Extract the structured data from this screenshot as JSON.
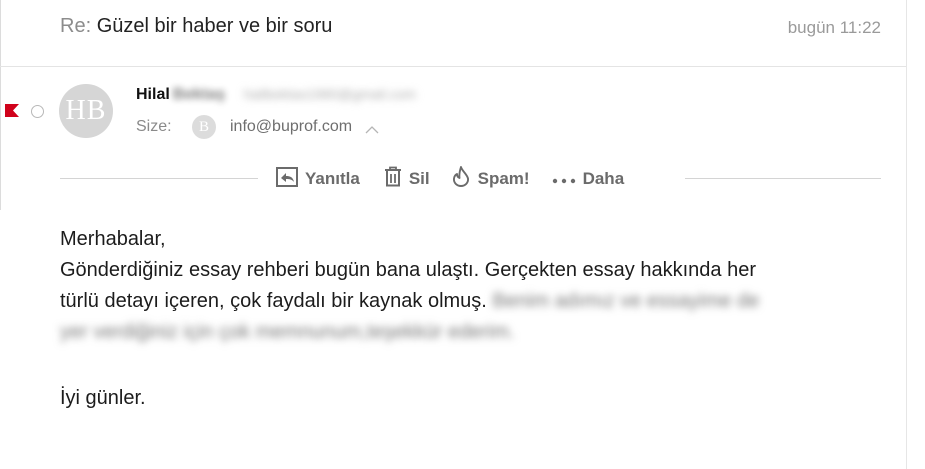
{
  "email": {
    "subject_prefix": "Re:",
    "subject": "Güzel bir haber ve bir soru",
    "date": "bugün 11:22",
    "sender": {
      "first_name": "Hilal",
      "last_name": "Bektaş",
      "email": "hailbektas1980@gmail.com",
      "avatar_initials": "HB"
    },
    "to": {
      "label": "Size:",
      "avatar_initial": "B",
      "email": "info@buprof.com"
    },
    "actions": {
      "reply": "Yanıtla",
      "delete": "Sil",
      "spam": "Spam!",
      "more": "Daha"
    },
    "body": {
      "greeting": "Merhabalar,",
      "line1": "Gönderdiğiniz essay rehberi bugün bana ulaştı. Gerçekten essay hakkında her",
      "line2": "türlü detayı içeren, çok faydalı bir kaynak olmuş.",
      "line2_blurred": " Benim adımız ve essayime de",
      "line3_blurred": "yer verdiğiniz için çok memnunum,teşekkür ederim.",
      "closing": "İyi günler."
    }
  },
  "colors": {
    "flag": "#d0021b",
    "avatar_bg": "#d6d6d6",
    "action_text": "#6b6b6b"
  },
  "icons": [
    "flag-icon",
    "unread-dot-icon",
    "reply-icon",
    "trash-icon",
    "fire-icon",
    "more-dots-icon",
    "chevron-up-icon"
  ]
}
